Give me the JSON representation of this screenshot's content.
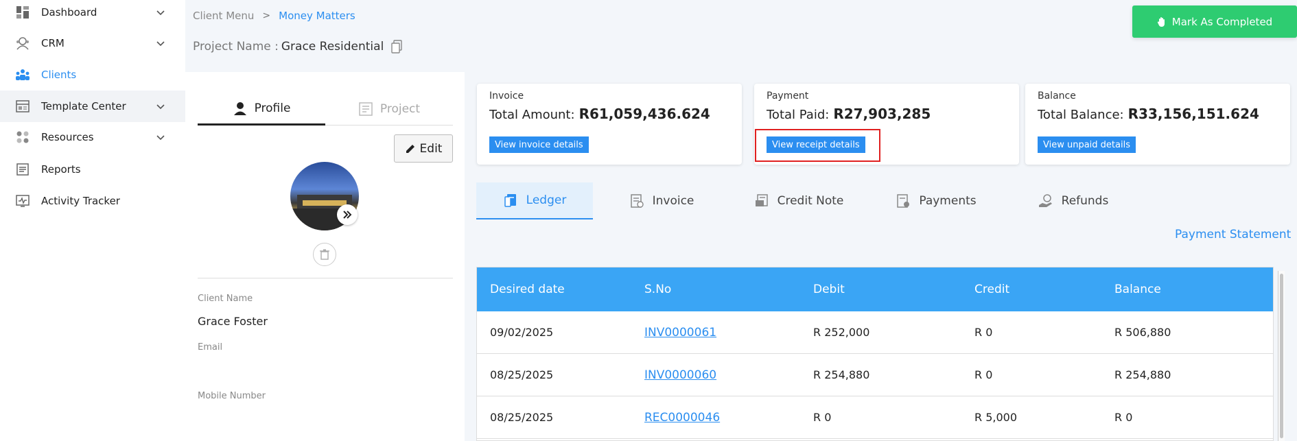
{
  "sidebar": {
    "items": [
      {
        "label": "Dashboard",
        "icon": "dashboard-icon",
        "expandable": true
      },
      {
        "label": "CRM",
        "icon": "crm-icon",
        "expandable": true
      },
      {
        "label": "Clients",
        "icon": "clients-icon",
        "active": true
      },
      {
        "label": "Template Center",
        "icon": "template-icon",
        "expandable": true
      },
      {
        "label": "Resources",
        "icon": "resources-icon",
        "expandable": true
      },
      {
        "label": "Reports",
        "icon": "reports-icon"
      },
      {
        "label": "Activity Tracker",
        "icon": "activity-icon"
      }
    ]
  },
  "breadcrumb": {
    "parent": "Client Menu",
    "separator": ">",
    "current": "Money Matters"
  },
  "project": {
    "label": "Project Name :",
    "value": "Grace Residential"
  },
  "header": {
    "mark_completed": "Mark As Completed"
  },
  "profile": {
    "tabs": [
      {
        "label": "Profile"
      },
      {
        "label": "Project"
      }
    ],
    "edit_label": "Edit",
    "fields": {
      "client_name_label": "Client Name",
      "client_name": "Grace Foster",
      "email_label": "Email",
      "mobile_label": "Mobile Number"
    }
  },
  "cards": {
    "invoice": {
      "title": "Invoice",
      "amount_label": "Total Amount:",
      "amount": "R61,059,436.624",
      "button": "View invoice details"
    },
    "payment": {
      "title": "Payment",
      "amount_label": "Total Paid:",
      "amount": "R27,903,285",
      "button": "View receipt details"
    },
    "balance": {
      "title": "Balance",
      "amount_label": "Total Balance:",
      "amount": "R33,156,151.624",
      "button": "View unpaid details"
    }
  },
  "ledger_tabs": [
    {
      "label": "Ledger",
      "active": true
    },
    {
      "label": "Invoice"
    },
    {
      "label": "Credit Note"
    },
    {
      "label": "Payments"
    },
    {
      "label": "Refunds"
    }
  ],
  "payment_statement": "Payment Statement",
  "table": {
    "headers": [
      "Desired date",
      "S.No",
      "Debit",
      "Credit",
      "Balance"
    ],
    "rows": [
      {
        "date": "09/02/2025",
        "sno": "INV0000061",
        "debit": "R 252,000",
        "credit": "R 0",
        "balance": "R 506,880"
      },
      {
        "date": "08/25/2025",
        "sno": "INV0000060",
        "debit": "R 254,880",
        "credit": "R 0",
        "balance": "R 254,880"
      },
      {
        "date": "08/25/2025",
        "sno": "REC0000046",
        "debit": "R 0",
        "credit": "R 5,000",
        "balance": "R 0"
      }
    ]
  },
  "colors": {
    "accent": "#2b8ef0",
    "success": "#2ecc71",
    "table_header": "#3aa5f5",
    "highlight": "#e02020"
  }
}
